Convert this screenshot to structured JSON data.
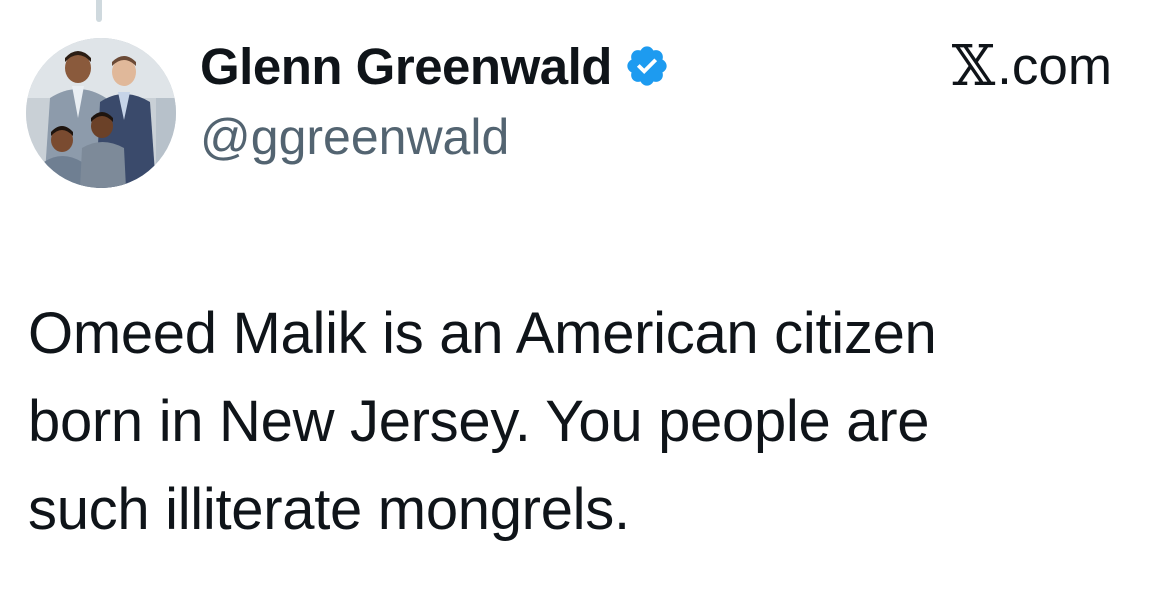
{
  "colors": {
    "text_primary": "#0f1419",
    "text_secondary": "#536471",
    "verified_blue": "#1d9bf0",
    "thread_line": "#cfd9de"
  },
  "author": {
    "display_name": "Glenn Greenwald",
    "handle": "@ggreenwald",
    "verified": true,
    "verified_icon": "verified-badge-icon"
  },
  "site": {
    "x_glyph": "𝕏",
    "label": ".com"
  },
  "tweet": {
    "lines": [
      "Omeed Malik is an American citizen",
      "born in New Jersey. You people are",
      "such illiterate mongrels."
    ]
  }
}
